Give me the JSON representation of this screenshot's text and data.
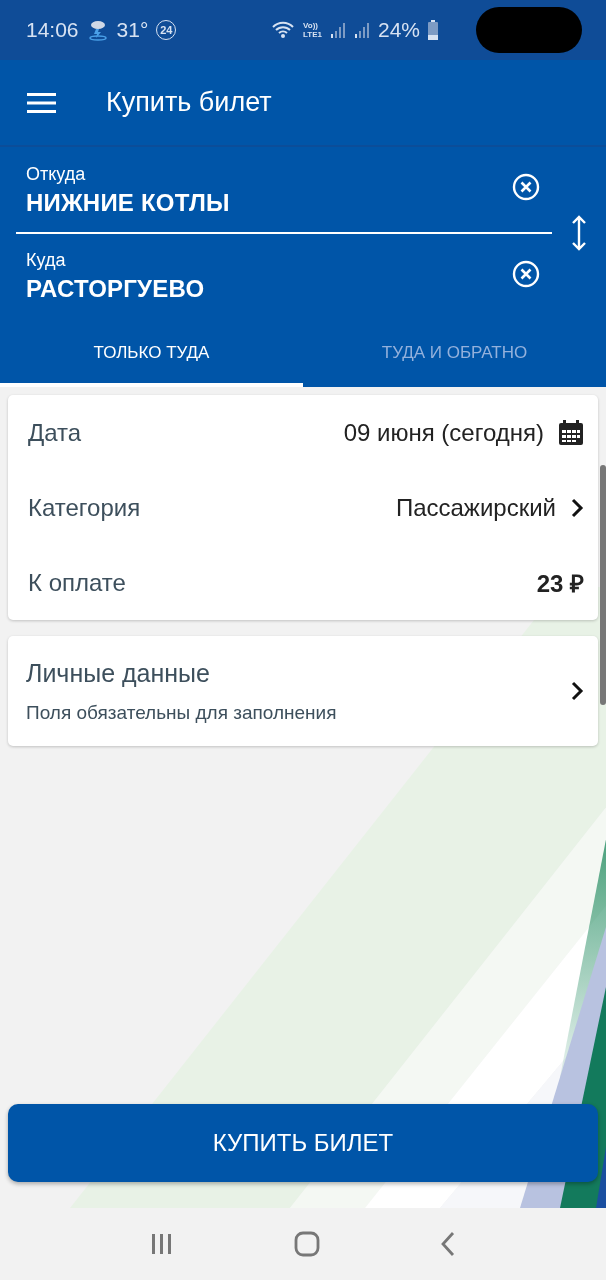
{
  "status_bar": {
    "time": "14:06",
    "temperature": "31°",
    "badge": "24",
    "volte": "Vo))",
    "network": "LTE1",
    "battery": "24%"
  },
  "app_bar": {
    "title": "Купить билет"
  },
  "route": {
    "fields": [
      {
        "label": "Откуда",
        "value": "НИЖНИЕ КОТЛЫ"
      },
      {
        "label": "Куда",
        "value": "РАСТОРГУЕВО"
      }
    ]
  },
  "tabs": [
    {
      "label": "ТОЛЬКО ТУДА",
      "selected": true
    },
    {
      "label": "ТУДА И ОБРАТНО",
      "selected": false
    }
  ],
  "details": [
    {
      "kind": "date",
      "label": "Дата",
      "value": "09 июня (сегодня)"
    },
    {
      "kind": "link",
      "label": "Категория",
      "value": "Пассажирский"
    },
    {
      "kind": "plain",
      "label": "К оплате",
      "value": "23 ₽"
    }
  ],
  "personal": {
    "title": "Личные данные",
    "subtitle": "Поля обязательны для заполнения"
  },
  "buy_button": "КУПИТЬ БИЛЕТ"
}
